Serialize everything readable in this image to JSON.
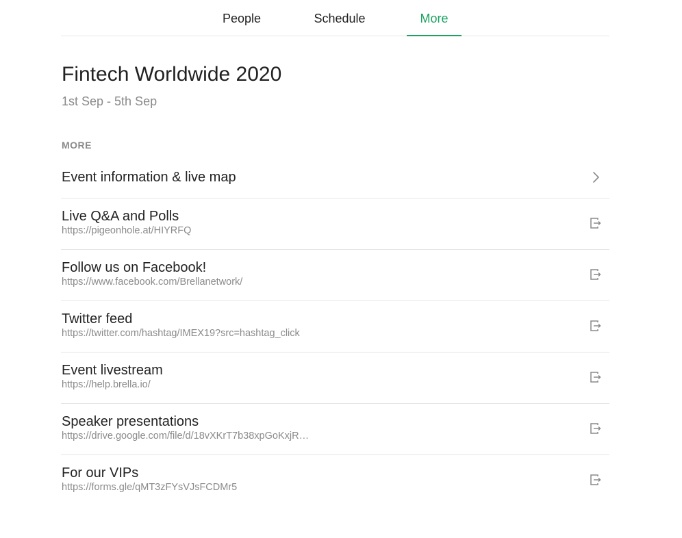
{
  "tabs": [
    {
      "label": "People",
      "active": false
    },
    {
      "label": "Schedule",
      "active": false
    },
    {
      "label": "More",
      "active": true
    }
  ],
  "colors": {
    "accent": "#1aa260",
    "muted": "#8a8a8a",
    "divider": "#e6e6e6"
  },
  "event": {
    "title": "Fintech Worldwide 2020",
    "dates": "1st Sep - 5th Sep"
  },
  "more": {
    "section_label": "MORE",
    "items": [
      {
        "title": "Event information & live map",
        "icon": "chevron-right-icon"
      },
      {
        "title": "Live Q&A and Polls",
        "url": "https://pigeonhole.at/HIYRFQ",
        "icon": "external-link-icon"
      },
      {
        "title": "Follow us on Facebook!",
        "url": "https://www.facebook.com/Brellanetwork/",
        "icon": "external-link-icon"
      },
      {
        "title": "Twitter feed",
        "url": "https://twitter.com/hashtag/IMEX19?src=hashtag_click",
        "icon": "external-link-icon"
      },
      {
        "title": "Event livestream",
        "url": "https://help.brella.io/",
        "icon": "external-link-icon"
      },
      {
        "title": "Speaker presentations",
        "url": "https://drive.google.com/file/d/18vXKrT7b38xpGoKxjR…",
        "icon": "external-link-icon"
      },
      {
        "title": "For our VIPs",
        "url": "https://forms.gle/qMT3zFYsVJsFCDMr5",
        "icon": "external-link-icon"
      }
    ]
  }
}
